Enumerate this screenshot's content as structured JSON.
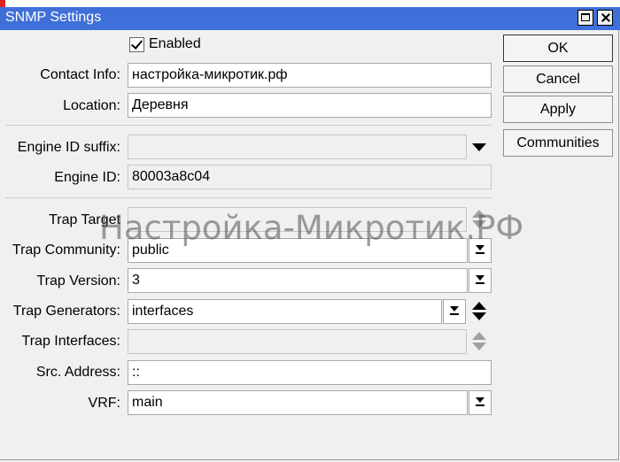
{
  "window": {
    "title": "SNMP Settings"
  },
  "enabled": {
    "label": "Enabled",
    "checked": true
  },
  "fields": {
    "contact_info": {
      "label": "Contact Info:",
      "value": "настройка-микротик.рф"
    },
    "location": {
      "label": "Location:",
      "value": "Деревня"
    },
    "engine_id_suffix": {
      "label": "Engine ID suffix:",
      "value": ""
    },
    "engine_id": {
      "label": "Engine ID:",
      "value": "80003a8c04"
    },
    "trap_target": {
      "label": "Trap Target",
      "value": ""
    },
    "trap_community": {
      "label": "Trap Community:",
      "value": "public"
    },
    "trap_version": {
      "label": "Trap Version:",
      "value": "3"
    },
    "trap_generators": {
      "label": "Trap Generators:",
      "value": "interfaces"
    },
    "trap_interfaces": {
      "label": "Trap Interfaces:",
      "value": ""
    },
    "src_address": {
      "label": "Src. Address:",
      "value": "::"
    },
    "vrf": {
      "label": "VRF:",
      "value": "main"
    }
  },
  "buttons": {
    "ok": "OK",
    "cancel": "Cancel",
    "apply": "Apply",
    "communities": "Communities"
  },
  "watermark": "Настройка-Микротик.РФ"
}
